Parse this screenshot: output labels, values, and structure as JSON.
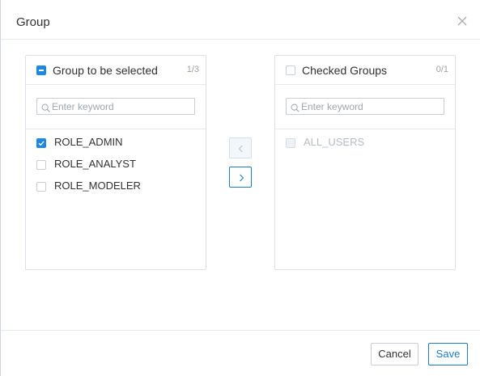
{
  "dialog": {
    "title": "Group",
    "close_icon": "close-icon"
  },
  "left_panel": {
    "header_checkbox_state": "indeterminate",
    "title": "Group to be selected",
    "count": "1/3",
    "filter_placeholder": "Enter keyword",
    "filter_value": "",
    "items": [
      {
        "label": "ROLE_ADMIN",
        "checked": true,
        "disabled": false
      },
      {
        "label": "ROLE_ANALYST",
        "checked": false,
        "disabled": false
      },
      {
        "label": "ROLE_MODELER",
        "checked": false,
        "disabled": false
      }
    ]
  },
  "right_panel": {
    "header_checkbox_state": "unchecked",
    "title": "Checked Groups",
    "count": "0/1",
    "filter_placeholder": "Enter keyword",
    "filter_value": "",
    "items": [
      {
        "label": "ALL_USERS",
        "checked": false,
        "disabled": true
      }
    ]
  },
  "transfer_buttons": {
    "to_left_icon": "chevron-left-icon",
    "to_left_disabled": true,
    "to_right_icon": "chevron-right-icon",
    "to_right_disabled": false
  },
  "footer": {
    "cancel_label": "Cancel",
    "save_label": "Save"
  },
  "colors": {
    "accent": "#1e88e5",
    "primary_border": "#1e7bc8",
    "border": "#dcdfe6",
    "disabled_text": "#b7bcc4"
  }
}
